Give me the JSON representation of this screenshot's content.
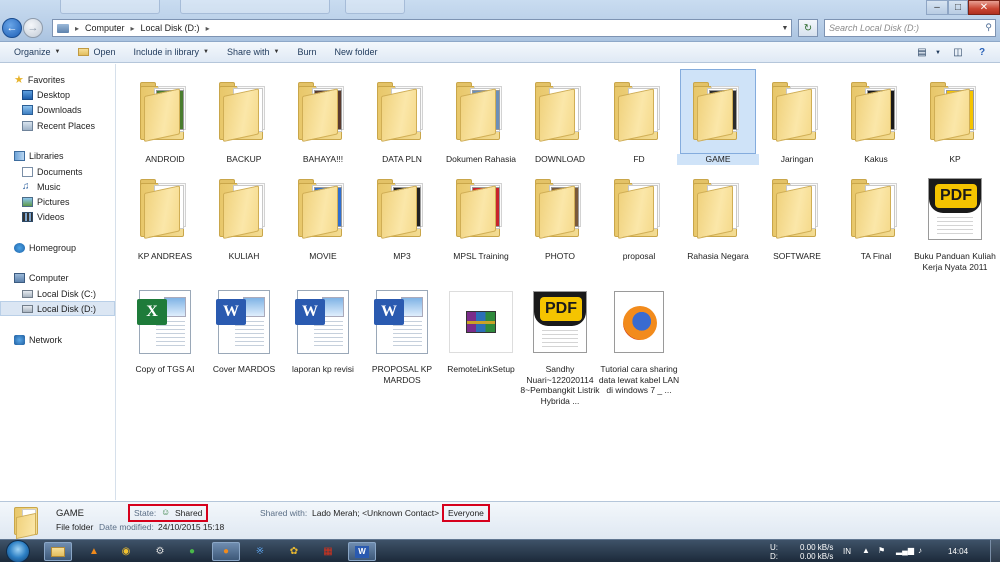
{
  "window": {
    "breadcrumb": [
      "Computer",
      "Local Disk (D:)"
    ],
    "search_placeholder": "Search Local Disk (D:)"
  },
  "toolbar": {
    "organize": "Organize",
    "open": "Open",
    "include_in_library": "Include in library",
    "share_with": "Share with",
    "burn": "Burn",
    "new_folder": "New folder"
  },
  "nav": {
    "favorites": "Favorites",
    "desktop": "Desktop",
    "downloads": "Downloads",
    "recent_places": "Recent Places",
    "libraries": "Libraries",
    "documents": "Documents",
    "music": "Music",
    "pictures": "Pictures",
    "videos": "Videos",
    "homegroup": "Homegroup",
    "computer": "Computer",
    "local_c": "Local Disk (C:)",
    "local_d": "Local Disk (D:)",
    "network": "Network"
  },
  "items": [
    {
      "label": "ANDROID",
      "kind": "folder",
      "accent": "#4a7d2f"
    },
    {
      "label": "BACKUP",
      "kind": "folder",
      "accent": ""
    },
    {
      "label": "BAHAYA!!!",
      "kind": "folder",
      "accent": "#5b3b2e"
    },
    {
      "label": "DATA PLN",
      "kind": "folder",
      "accent": ""
    },
    {
      "label": "Dokumen Rahasia",
      "kind": "folder",
      "accent": "#6c8fb8"
    },
    {
      "label": "DOWNLOAD",
      "kind": "folder",
      "accent": ""
    },
    {
      "label": "FD",
      "kind": "folder",
      "accent": ""
    },
    {
      "label": "GAME",
      "kind": "folder-selected",
      "accent": "#2b2b2b"
    },
    {
      "label": "Jaringan",
      "kind": "folder",
      "accent": ""
    },
    {
      "label": "Kakus",
      "kind": "folder",
      "accent": "#1a1a1a"
    },
    {
      "label": "KP",
      "kind": "folder",
      "accent": "#f5c400"
    },
    {
      "label": "KP ANDREAS",
      "kind": "folder",
      "accent": ""
    },
    {
      "label": "KULIAH",
      "kind": "folder",
      "accent": ""
    },
    {
      "label": "MOVIE",
      "kind": "folder",
      "accent": "#2f6fd0"
    },
    {
      "label": "MP3",
      "kind": "folder",
      "accent": "#222"
    },
    {
      "label": "MPSL Training",
      "kind": "folder",
      "accent": "#c8232c"
    },
    {
      "label": "PHOTO",
      "kind": "folder",
      "accent": "#7a5a3a"
    },
    {
      "label": "proposal",
      "kind": "folder",
      "accent": ""
    },
    {
      "label": "Rahasia Negara",
      "kind": "folder",
      "accent": ""
    },
    {
      "label": "SOFTWARE",
      "kind": "folder",
      "accent": ""
    },
    {
      "label": "TA Final",
      "kind": "folder",
      "accent": ""
    },
    {
      "label": "Buku Panduan Kuliah Kerja Nyata 2011",
      "kind": "pdf",
      "accent": ""
    },
    {
      "label": "Copy of TGS AI",
      "kind": "excel",
      "accent": "#1e7b3a"
    },
    {
      "label": "Cover MARDOS",
      "kind": "word",
      "accent": "#2a5ab0"
    },
    {
      "label": "laporan kp revisi",
      "kind": "word",
      "accent": "#2a5ab0"
    },
    {
      "label": "PROPOSAL KP MARDOS",
      "kind": "word",
      "accent": "#2a5ab0"
    },
    {
      "label": "RemoteLinkSetup",
      "kind": "rar",
      "accent": ""
    },
    {
      "label": "Sandhy Nuari~122020114 8~Pembangkit Listrik Hybrida ...",
      "kind": "pdf",
      "accent": ""
    },
    {
      "label": "Tutorial cara sharing data lewat kabel LAN di windows 7 _ ...",
      "kind": "firefox",
      "accent": ""
    }
  ],
  "details": {
    "name": "GAME",
    "type": "File folder",
    "date_label": "Date modified:",
    "date_value": "24/10/2015 15:18",
    "state_label": "State:",
    "state_value": "Shared",
    "shared_label": "Shared with:",
    "shared_value": "Lado Merah; <Unknown Contact>",
    "shared_highlight": "Everyone"
  },
  "taskbar": {
    "net_u_label": "U:",
    "net_d_label": "D:",
    "net_u_value": "0.00 kB/s",
    "net_d_value": "0.00 kB/s",
    "lang": "IN",
    "clock": "14:04"
  }
}
